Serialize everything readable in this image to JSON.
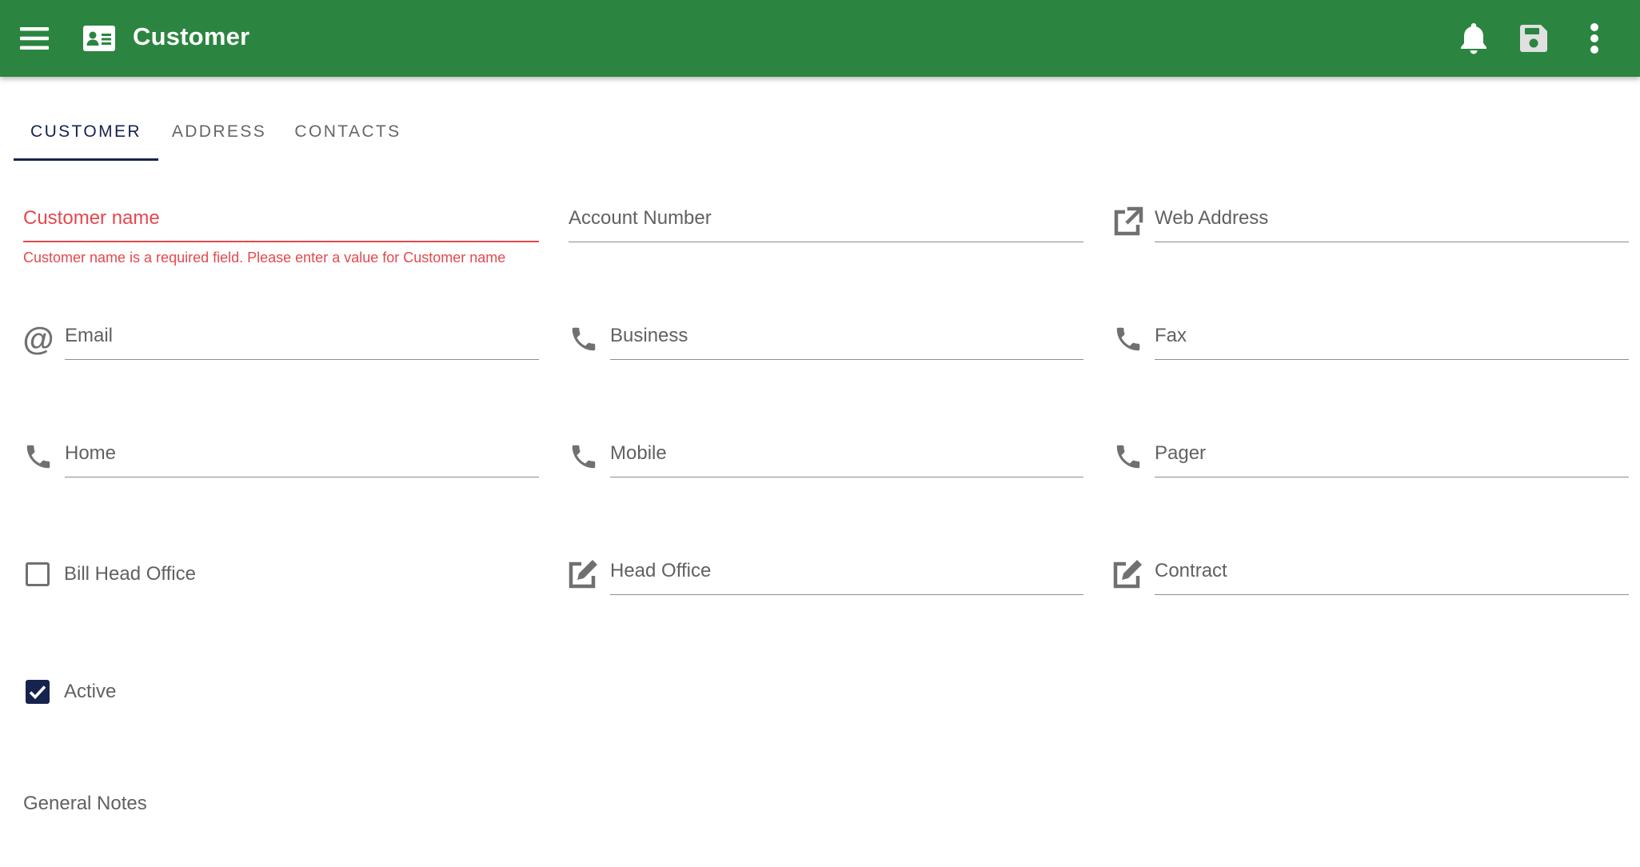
{
  "appbar": {
    "title": "Customer",
    "color": "#2b8540",
    "icons": [
      "menu-icon",
      "contact-card-icon",
      "bell-icon",
      "save-icon",
      "more-vert-icon"
    ]
  },
  "tabs": [
    {
      "label": "CUSTOMER",
      "active": true
    },
    {
      "label": "ADDRESS",
      "active": false
    },
    {
      "label": "CONTACTS",
      "active": false
    }
  ],
  "form": {
    "customer_name": {
      "label": "Customer name",
      "value": "",
      "error": "Customer name is a required field. Please enter a value for Customer name"
    },
    "account_number": {
      "label": "Account Number",
      "value": ""
    },
    "web_address": {
      "label": "Web Address",
      "value": "",
      "icon": "open-external-icon"
    },
    "email": {
      "label": "Email",
      "value": "",
      "icon": "at-icon"
    },
    "business": {
      "label": "Business",
      "value": "",
      "icon": "phone-icon"
    },
    "fax": {
      "label": "Fax",
      "value": "",
      "icon": "phone-icon"
    },
    "home": {
      "label": "Home",
      "value": "",
      "icon": "phone-icon"
    },
    "mobile": {
      "label": "Mobile",
      "value": "",
      "icon": "phone-icon"
    },
    "pager": {
      "label": "Pager",
      "value": "",
      "icon": "phone-icon"
    },
    "bill_head_office": {
      "label": "Bill Head Office",
      "checked": false
    },
    "head_office": {
      "label": "Head Office",
      "value": "",
      "icon": "edit-icon"
    },
    "contract": {
      "label": "Contract",
      "value": "",
      "icon": "edit-icon"
    },
    "active": {
      "label": "Active",
      "checked": true
    },
    "general_notes": {
      "label": "General Notes"
    }
  },
  "colors": {
    "primary": "#15234e",
    "error": "#e5484d",
    "appbar": "#2b8540"
  }
}
